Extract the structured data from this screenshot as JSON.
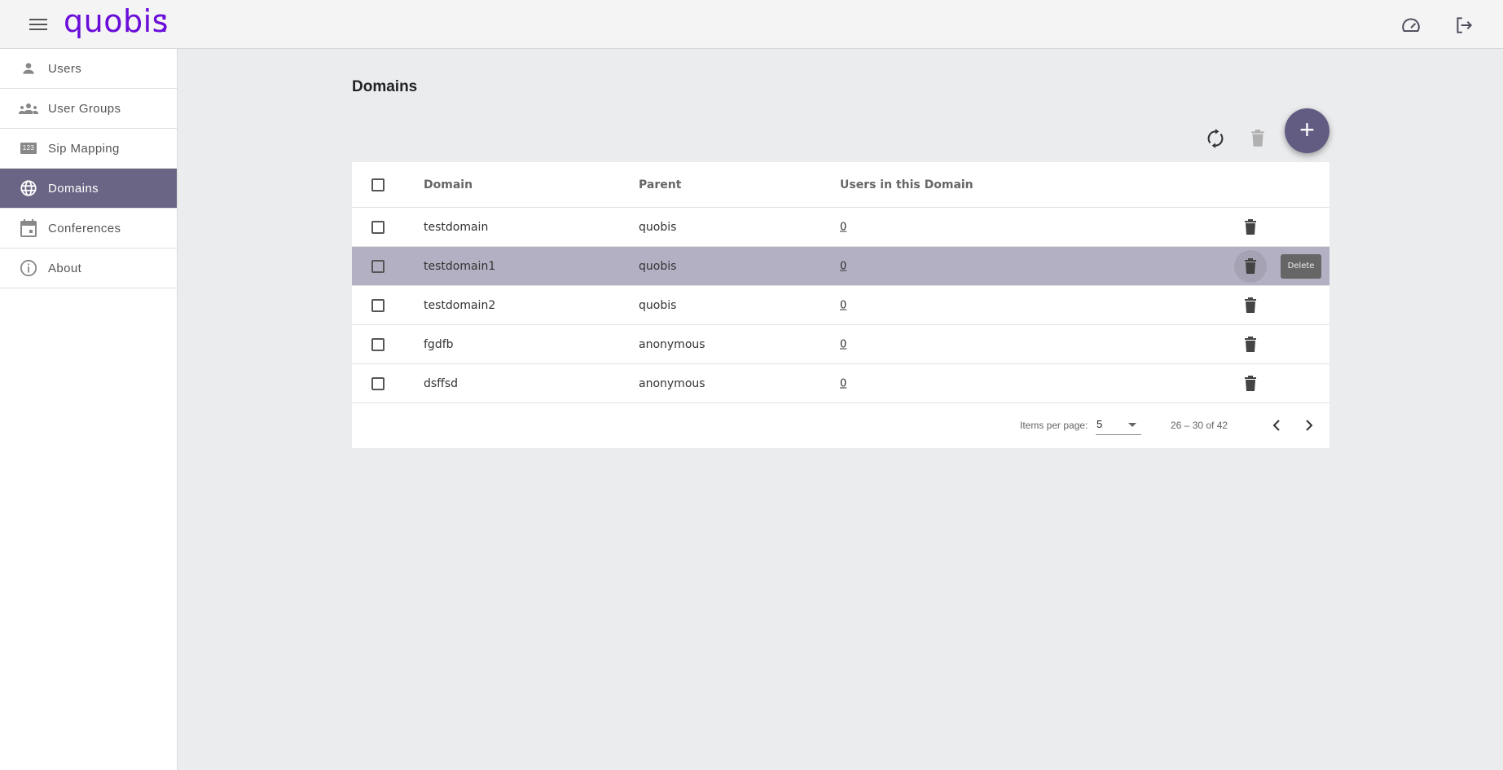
{
  "header": {
    "logo": "quobis",
    "icons": [
      "menu-icon",
      "dashboard-icon",
      "logout-icon"
    ]
  },
  "sidebar": {
    "items": [
      {
        "label": "Users",
        "icon": "person-icon"
      },
      {
        "label": "User Groups",
        "icon": "groups-icon"
      },
      {
        "label": "Sip Mapping",
        "icon": "numbers-icon"
      },
      {
        "label": "Domains",
        "icon": "globe-icon",
        "active": true
      },
      {
        "label": "Conferences",
        "icon": "calendar-icon"
      },
      {
        "label": "About",
        "icon": "info-icon"
      }
    ]
  },
  "main": {
    "title": "Domains",
    "toolbar": {
      "refresh": "refresh-icon",
      "delete": "delete-icon",
      "add": "+"
    },
    "table": {
      "columns": [
        "Domain",
        "Parent",
        "Users in this Domain"
      ],
      "rows": [
        {
          "domain": "testdomain",
          "parent": "quobis",
          "users": "0"
        },
        {
          "domain": "testdomain1",
          "parent": "quobis",
          "users": "0"
        },
        {
          "domain": "testdomain2",
          "parent": "quobis",
          "users": "0"
        },
        {
          "domain": "fgdfb",
          "parent": "anonymous",
          "users": "0"
        },
        {
          "domain": "dsffsd",
          "parent": "anonymous",
          "users": "0"
        }
      ],
      "tooltip": "Delete"
    },
    "paginator": {
      "items_per_page_label": "Items per page:",
      "items_per_page": "5",
      "range": "26 – 30 of 42"
    }
  },
  "colors": {
    "accent": "#625c82",
    "sidebar_active": "#6a6584",
    "row_hover": "#b3b0c3",
    "logo": "#6a0dd8"
  }
}
